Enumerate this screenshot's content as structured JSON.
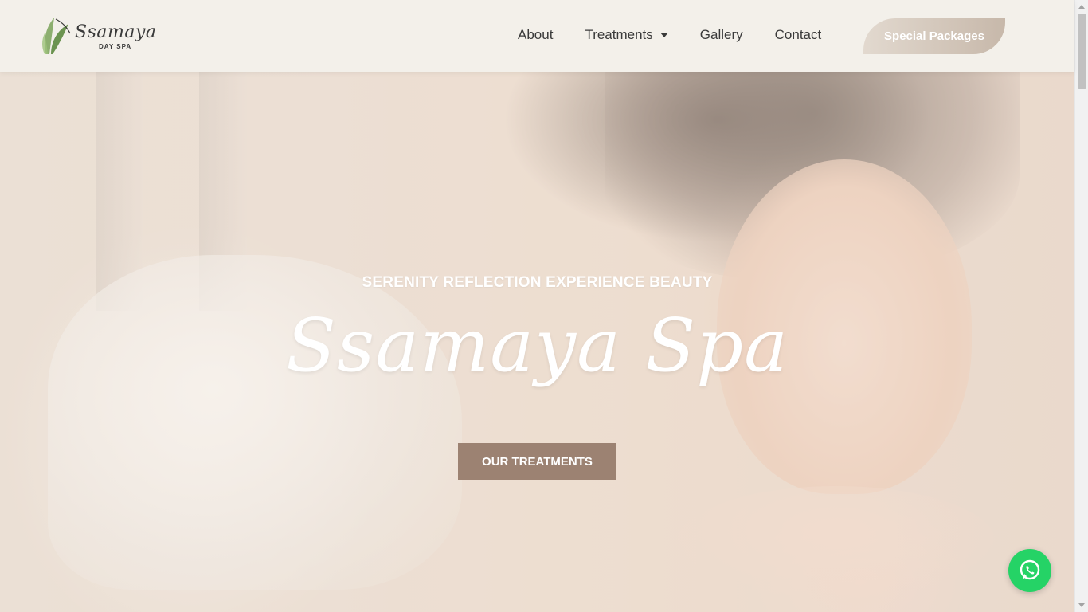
{
  "header": {
    "logo": {
      "word": "Ssamaya",
      "sub": "DAY SPA"
    },
    "nav": [
      {
        "label": "About"
      },
      {
        "label": "Treatments",
        "has_dropdown": true
      },
      {
        "label": "Gallery"
      },
      {
        "label": "Contact"
      }
    ],
    "special_label": "Special Packages"
  },
  "hero": {
    "tagline": "SERENITY REFLECTION EXPERIENCE BEAUTY",
    "title": "Ssamaya Spa",
    "cta_label": "OUR TREATMENTS"
  },
  "colors": {
    "background": "#f3f0ea",
    "cta": "#9c8272",
    "whatsapp": "#25d366",
    "text_dark": "#3a3a3a"
  },
  "icons": {
    "logo": "lotus-leaf-icon",
    "dropdown": "caret-down-icon",
    "chat": "whatsapp-icon"
  }
}
